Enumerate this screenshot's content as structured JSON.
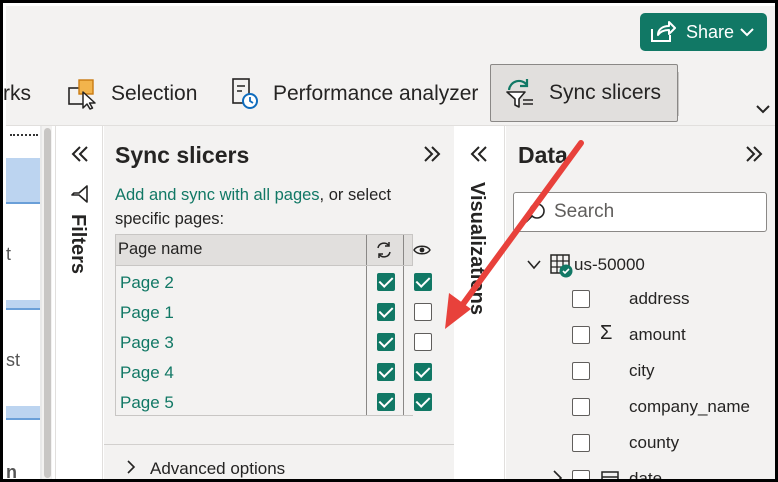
{
  "header": {
    "share_label": "Share"
  },
  "ribbon": {
    "items": [
      {
        "label": "rks",
        "icon": "bookmark-icon"
      },
      {
        "label": "Selection",
        "icon": "selection-icon"
      },
      {
        "label": "Performance analyzer",
        "icon": "performance-icon"
      },
      {
        "label": "Sync slicers",
        "icon": "sync-slicers-icon"
      }
    ]
  },
  "canvas": {
    "text_1": "t",
    "text_2": "st",
    "text_3": "n"
  },
  "filters": {
    "label": "Filters"
  },
  "sync_pane": {
    "title": "Sync slicers",
    "desc_link": "Add and sync with all pages",
    "desc_rest": ", or select specific pages:",
    "col_page_name": "Page name",
    "pages": [
      {
        "name": "Page 2",
        "sync": true,
        "visible": true
      },
      {
        "name": "Page 1",
        "sync": true,
        "visible": false
      },
      {
        "name": "Page 3",
        "sync": true,
        "visible": false
      },
      {
        "name": "Page 4",
        "sync": true,
        "visible": true
      },
      {
        "name": "Page 5",
        "sync": true,
        "visible": true
      }
    ],
    "advanced_label": "Advanced options"
  },
  "visualizations": {
    "label": "Visualizations"
  },
  "data_pane": {
    "title": "Data",
    "search_placeholder": "Search",
    "table_name": "us-50000",
    "fields": [
      {
        "name": "address",
        "icon": ""
      },
      {
        "name": "amount",
        "icon": "Σ"
      },
      {
        "name": "city",
        "icon": ""
      },
      {
        "name": "company_name",
        "icon": ""
      },
      {
        "name": "county",
        "icon": ""
      },
      {
        "name": "date",
        "icon": "calendar"
      }
    ]
  },
  "colors": {
    "accent": "#117865",
    "arrow": "#e8413b",
    "pane_bg": "#f3f2f1"
  }
}
